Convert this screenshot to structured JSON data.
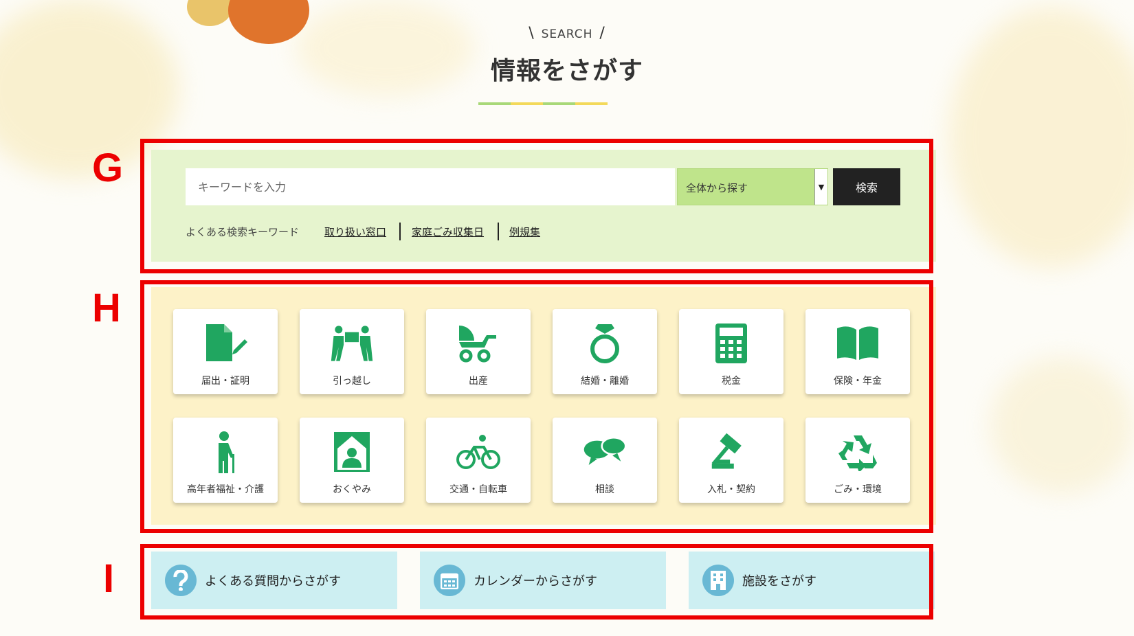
{
  "header": {
    "eyebrow": "SEARCH",
    "slash_left": "\\",
    "slash_right": "/",
    "title": "情報をさがす"
  },
  "markers": {
    "g": "G",
    "h": "H",
    "i": "I"
  },
  "search": {
    "placeholder": "キーワードを入力",
    "scope_selected": "全体から探す",
    "button_label": "検索",
    "popular_label": "よくある検索キーワード",
    "keywords": [
      "取り扱い窓口",
      "家庭ごみ収集日",
      "例規集"
    ]
  },
  "categories": [
    {
      "label": "届出・証明",
      "icon": "document-pen-icon"
    },
    {
      "label": "引っ越し",
      "icon": "moving-people-icon"
    },
    {
      "label": "出産",
      "icon": "stroller-icon"
    },
    {
      "label": "結婚・離婚",
      "icon": "ring-icon"
    },
    {
      "label": "税金",
      "icon": "calculator-icon"
    },
    {
      "label": "保険・年金",
      "icon": "book-icon"
    },
    {
      "label": "高年者福祉・介護",
      "icon": "elderly-icon"
    },
    {
      "label": "おくやみ",
      "icon": "memorial-icon"
    },
    {
      "label": "交通・自転車",
      "icon": "bicycle-icon"
    },
    {
      "label": "相談",
      "icon": "speech-bubbles-icon"
    },
    {
      "label": "入札・契約",
      "icon": "gavel-icon"
    },
    {
      "label": "ごみ・環境",
      "icon": "recycle-icon"
    }
  ],
  "links": [
    {
      "label": "よくある質問からさがす",
      "icon": "question-icon"
    },
    {
      "label": "カレンダーからさがす",
      "icon": "calendar-icon"
    },
    {
      "label": "施設をさがす",
      "icon": "building-icon"
    }
  ],
  "colors": {
    "accent_green": "#20a660",
    "frame_red": "#ec0000",
    "search_bg": "#e6f4ce",
    "category_bg": "#fdf2c8",
    "link_bg": "#cdeff2",
    "link_icon": "#68b8d4"
  }
}
